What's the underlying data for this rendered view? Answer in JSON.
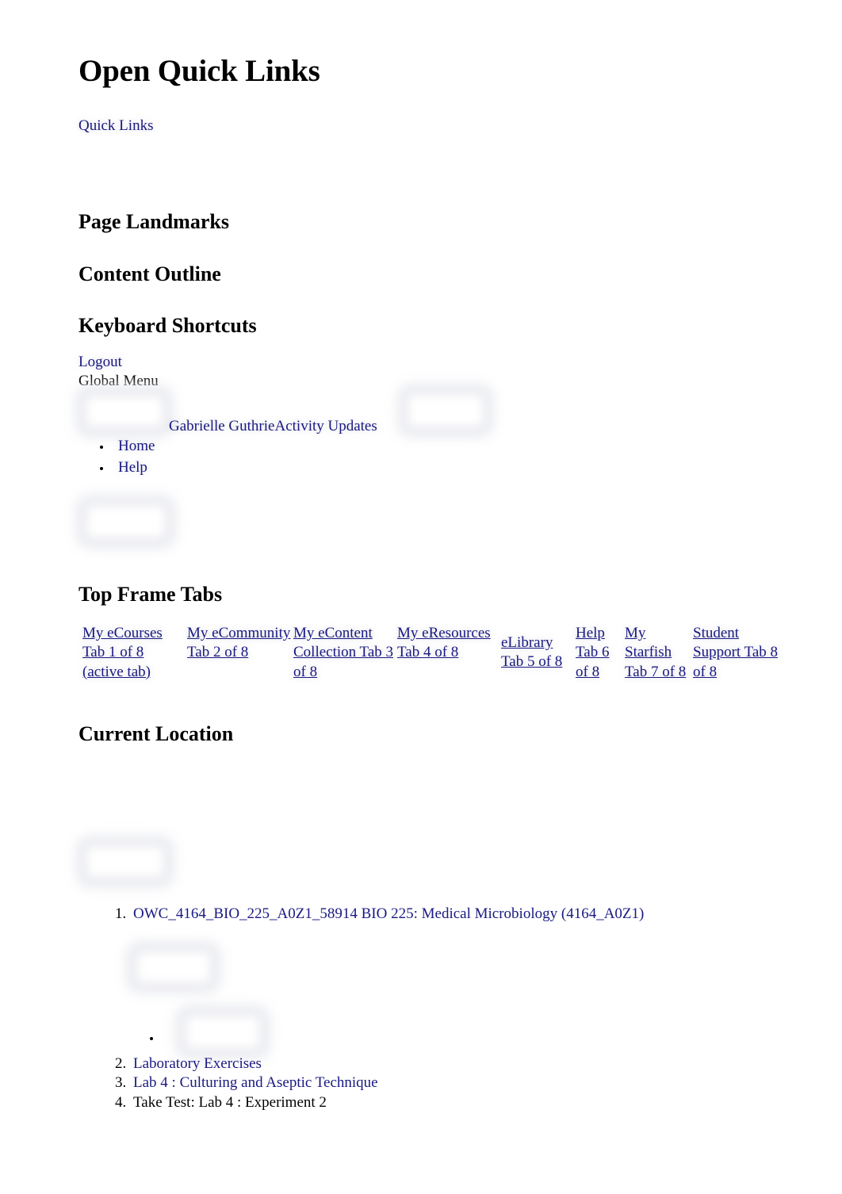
{
  "page": {
    "title": "Open Quick Links",
    "quick_links_label": "Quick Links"
  },
  "landmarks": {
    "page_landmarks_heading": "Page Landmarks",
    "content_outline_heading": "Content Outline",
    "keyboard_shortcuts_heading": "Keyboard Shortcuts"
  },
  "global_menu": {
    "logout_label": "Logout",
    "global_menu_label": "Global Menu",
    "user_name": "Gabrielle Guthrie",
    "activity_updates_label": "Activity Updates",
    "items": [
      {
        "label": "Home"
      },
      {
        "label": "Help"
      }
    ]
  },
  "top_frame": {
    "heading": "Top Frame Tabs",
    "tabs": [
      {
        "label": "My eCourses Tab 1 of 8 (active tab)",
        "active": true
      },
      {
        "label": "My eCommunity Tab 2 of 8",
        "active": false
      },
      {
        "label": "My eContent Collection Tab 3 of 8",
        "active": false
      },
      {
        "label": "My eResources Tab 4 of 8",
        "active": false
      },
      {
        "label": "eLibrary Tab 5 of 8",
        "active": false
      },
      {
        "label": "Help Tab 6 of 8",
        "active": false
      },
      {
        "label": "My Starfish Tab 7 of 8",
        "active": false
      },
      {
        "label": "Student Support Tab 8 of 8",
        "active": false
      }
    ]
  },
  "current_location": {
    "heading": "Current Location",
    "breadcrumbs": [
      {
        "label": "OWC_4164_BIO_225_A0Z1_58914 BIO 225: Medical Microbiology (4164_A0Z1)",
        "is_link": true
      },
      {
        "label": "Laboratory Exercises",
        "is_link": true
      },
      {
        "label": "Lab 4 : Culturing and Aseptic Technique",
        "is_link": true
      },
      {
        "label": "Take Test: Lab 4 : Experiment 2",
        "is_link": false
      }
    ]
  },
  "colors": {
    "link": "#191982",
    "text": "#000000",
    "background": "#ffffff",
    "redaction_box": "#e9eaef"
  }
}
